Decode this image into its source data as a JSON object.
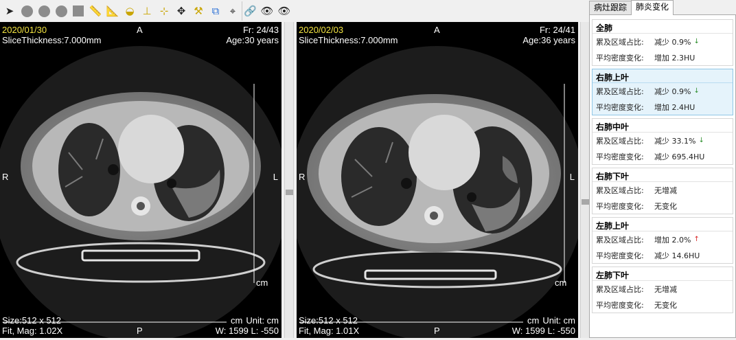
{
  "toolbar": {
    "tools": [
      {
        "name": "pointer-tool",
        "glyph": "➤",
        "style": "dark"
      },
      {
        "name": "circle-tool-1",
        "glyph": "",
        "style": "circle"
      },
      {
        "name": "circle-tool-2",
        "glyph": "",
        "style": "circle"
      },
      {
        "name": "circle-tool-3",
        "glyph": "",
        "style": "circle"
      },
      {
        "name": "rect-tool",
        "glyph": "",
        "style": "square"
      },
      {
        "name": "ruler-tool",
        "glyph": "📏",
        "style": "yellow"
      },
      {
        "name": "angle-ruler-tool",
        "glyph": "📐",
        "style": "yellow"
      },
      {
        "name": "protractor-tool",
        "glyph": "◒",
        "style": "yellow"
      },
      {
        "name": "level-tool",
        "glyph": "⊥",
        "style": "yellow"
      },
      {
        "name": "point-probe-tool",
        "glyph": "⊹",
        "style": "yellow"
      },
      {
        "name": "pan-tool",
        "glyph": "✥",
        "style": "dark"
      },
      {
        "name": "hammer-tool",
        "glyph": "⚒",
        "style": "yellow"
      },
      {
        "name": "copy-tool",
        "glyph": "⧉",
        "style": "blue"
      },
      {
        "name": "crosshair-tool",
        "glyph": "⌖",
        "style": "dark"
      },
      {
        "name": "link-tool",
        "glyph": "🔗",
        "style": "dark",
        "sep": true
      },
      {
        "name": "eye-tool-1",
        "glyph": "👁",
        "style": "dark"
      },
      {
        "name": "eye-tool-2",
        "glyph": "👁",
        "style": "dark"
      }
    ]
  },
  "viewers": [
    {
      "date": "2020/01/30",
      "orientation_top": "A",
      "frame": "Fr: 24/43",
      "slice_thickness": "SliceThickness:7.000mm",
      "age": "Age:30 years",
      "orientation_left": "R",
      "orientation_right": "L",
      "scale_unit_label": "cm",
      "size": "Size:512 x 512",
      "fit_mag": "Fit, Mag: 1.02X",
      "orientation_bottom": "P",
      "unit": "Unit:  cm",
      "window": "W: 1599 L: -550",
      "bottom_cm": "cm"
    },
    {
      "date": "2020/02/03",
      "orientation_top": "A",
      "frame": "Fr: 24/41",
      "slice_thickness": "SliceThickness:7.000mm",
      "age": "Age:36 years",
      "orientation_left": "R",
      "orientation_right": "L",
      "scale_unit_label": "cm",
      "size": "Size:512 x 512",
      "fit_mag": "Fit, Mag: 1.01X",
      "orientation_bottom": "P",
      "unit": "Unit:  cm",
      "window": "W: 1599 L: -550",
      "bottom_cm": "cm"
    }
  ],
  "tabs": [
    {
      "label": "病灶跟踪",
      "active": false
    },
    {
      "label": "肺炎变化",
      "active": true
    }
  ],
  "regions": [
    {
      "title": "全肺",
      "selected": false,
      "area_label": "累及区域占比:",
      "area_value": "减少 0.9%",
      "area_trend": "down",
      "density_label": "平均密度变化:",
      "density_value": "增加 2.3HU"
    },
    {
      "title": "右肺上叶",
      "selected": true,
      "area_label": "累及区域占比:",
      "area_value": "减少 0.9%",
      "area_trend": "down",
      "density_label": "平均密度变化:",
      "density_value": "增加 2.4HU"
    },
    {
      "title": "右肺中叶",
      "selected": false,
      "area_label": "累及区域占比:",
      "area_value": "减少 33.1%",
      "area_trend": "down",
      "density_label": "平均密度变化:",
      "density_value": "减少 695.4HU"
    },
    {
      "title": "右肺下叶",
      "selected": false,
      "area_label": "累及区域占比:",
      "area_value": "无增减",
      "area_trend": "none",
      "density_label": "平均密度变化:",
      "density_value": "无变化"
    },
    {
      "title": "左肺上叶",
      "selected": false,
      "area_label": "累及区域占比:",
      "area_value": "增加 2.0%",
      "area_trend": "up",
      "density_label": "平均密度变化:",
      "density_value": "减少 14.6HU"
    },
    {
      "title": "左肺下叶",
      "selected": false,
      "area_label": "累及区域占比:",
      "area_value": "无增减",
      "area_trend": "none",
      "density_label": "平均密度变化:",
      "density_value": "无变化"
    }
  ],
  "colors": {
    "date_text": "#f5e642",
    "overlay_text": "#ffffff",
    "selected_region": "#e5f3fb",
    "trend_down": "#2f8f2f",
    "trend_up": "#d62020"
  }
}
